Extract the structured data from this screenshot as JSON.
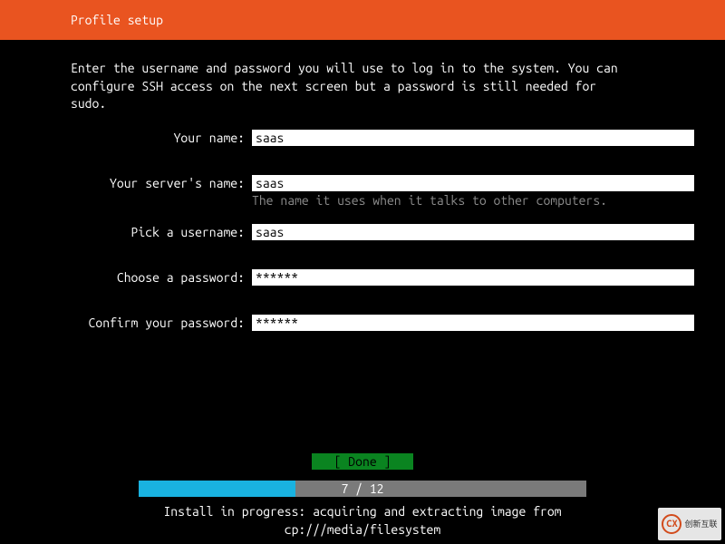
{
  "header": {
    "title": "Profile setup"
  },
  "instruction": "Enter the username and password you will use to log in to the system. You can\nconfigure SSH access on the next screen but a password is still needed for\nsudo.",
  "form": {
    "name": {
      "label": "Your name:",
      "value": "saas"
    },
    "server": {
      "label": "Your server's name:",
      "value": "saas",
      "hint": "The name it uses when it talks to other computers."
    },
    "username": {
      "label": "Pick a username:",
      "value": "saas"
    },
    "password": {
      "label": "Choose a password:",
      "value": "******"
    },
    "confirm": {
      "label": "Confirm your password:",
      "value": "******"
    }
  },
  "done_label": "[ Done       ]",
  "progress": {
    "current": 7,
    "total": 12,
    "label": "7 / 12",
    "percent": 35
  },
  "status": "Install in progress: acquiring and extracting image from\ncp:///media/filesystem",
  "watermark": {
    "badge": "CX",
    "text": "创新互联"
  }
}
